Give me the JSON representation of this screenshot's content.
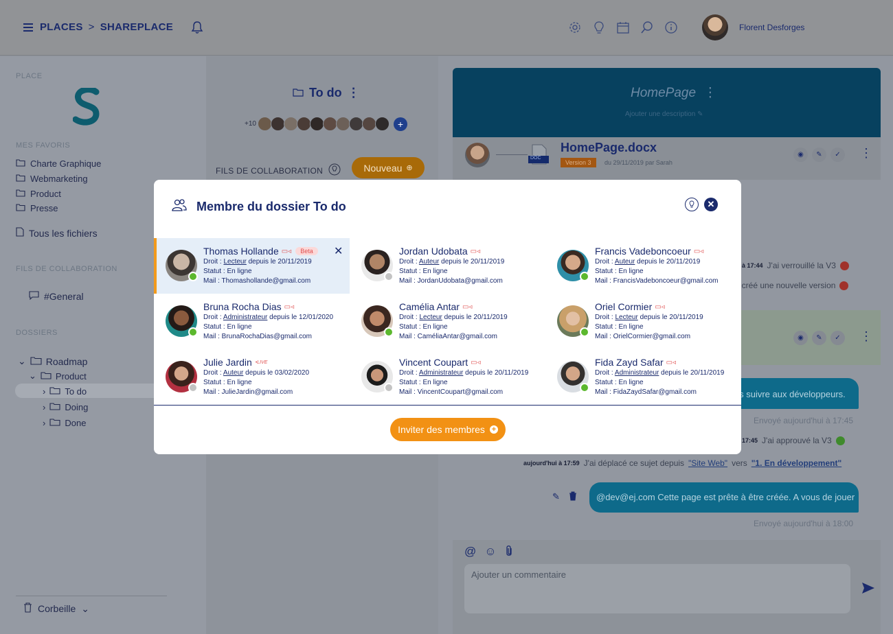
{
  "header": {
    "places_label": "PLACES",
    "crumb_separator": ">",
    "current_place": "SHAREPLACE",
    "user_name": "Florent Desforges",
    "icons": [
      "settings-icon",
      "lightbulb-icon",
      "calendar-icon",
      "search-icon",
      "info-icon"
    ]
  },
  "sidebar": {
    "place_title": "PLACE",
    "favorites_title": "MES FAVORIS",
    "favorites": [
      "Charte Graphique",
      "Webmarketing",
      "Product",
      "Presse"
    ],
    "all_files": "Tous les fichiers",
    "collab_title": "FILS DE COLLABORATION",
    "channel": "#General",
    "folders_title": "DOSSIERS",
    "tree": [
      {
        "label": "Roadmap"
      },
      {
        "label": "Product"
      },
      {
        "label": "To do"
      },
      {
        "label": "Doing"
      },
      {
        "label": "Done"
      }
    ],
    "trash": "Corbeille"
  },
  "middle": {
    "folder_title": "To do",
    "extra_members": "+10",
    "collab_label": "FILS DE COLLABORATION",
    "new_button": "Nouveau"
  },
  "right": {
    "page_title": "HomePage",
    "page_desc": "Ajouter une description",
    "doc_name": "HomePage.docx",
    "doc_type": "DOC",
    "version": "Version 3",
    "version_date": "du 29/11/2019 par Sarah",
    "log1_time": "à 17:44",
    "log1_text": "J'ai verrouillé la V3",
    "log2_text": "t créé une nouvelle version",
    "bubble1": "ais suivre aux développeurs.",
    "sent1": "Envoyé aujourd'hui à 17:45",
    "log3_time": "17:45",
    "log3_text": "J'ai approuvé la V3",
    "log4_time": "aujourd'hui à 17:59",
    "log4_a": "J'ai déplacé ce sujet depuis",
    "log4_from": "\"Site Web\"",
    "log4_vers": "vers",
    "log4_to": "\"1. En développement\"",
    "bubble2": "@dev@ej.com Cette page est prête à être créée. A vous de jouer",
    "sent2": "Envoyé aujourd'hui à 18:00",
    "comment_placeholder": "Ajouter un commentaire"
  },
  "modal": {
    "title": "Membre du dossier To do",
    "invite_button": "Inviter des membres",
    "close_symbol": "✕",
    "members": [
      {
        "name": "Thomas Hollande",
        "badge": "Beta",
        "droit_prefix": "Droit :",
        "role": "Lecteur",
        "since": "depuis le 20/11/2019",
        "statut": "Statut : En ligne",
        "mail": "Mail : Thomashollande@gmail.com",
        "online": true,
        "selected": true
      },
      {
        "name": "Jordan Udobata",
        "droit_prefix": "Droit :",
        "role": "Auteur",
        "since": "depuis le 20/11/2019",
        "statut": "Statut : En ligne",
        "mail": "Mail : JordanUdobata@gmail.com",
        "online": false
      },
      {
        "name": "Francis Vadeboncoeur",
        "droit_prefix": "Droit :",
        "role": "Auteur",
        "since": "depuis le 20/11/2019",
        "statut": "Statut : En ligne",
        "mail": "Mail : FrancisVadeboncoeur@gmail.com",
        "online": true
      },
      {
        "name": "Bruna Rocha Dias",
        "droit_prefix": "Droit :",
        "role": "Administrateur",
        "since": "depuis le 12/01/2020",
        "statut": "Statut : En ligne",
        "mail": "Mail : BrunaRochaDias@gmail.com",
        "online": true
      },
      {
        "name": "Camélia Antar",
        "droit_prefix": "Droit :",
        "role": "Lecteur",
        "since": "depuis le 20/11/2019",
        "statut": "Statut : En ligne",
        "mail": "Mail : CaméliaAntar@gmail.com",
        "online": true
      },
      {
        "name": "Oriel Cormier",
        "droit_prefix": "Droit :",
        "role": "Lecteur",
        "since": "depuis le 20/11/2019",
        "statut": "Statut : En ligne",
        "mail": "Mail : OrielCormier@gmail.com",
        "online": true
      },
      {
        "name": "Julie Jardin",
        "live": "LIVE",
        "droit_prefix": "Droit :",
        "role": "Auteur",
        "since": "depuis le 03/02/2020",
        "statut": "Statut : En ligne",
        "mail": "Mail : JulieJardin@gmail.com",
        "online": false
      },
      {
        "name": "Vincent Coupart",
        "droit_prefix": "Droit :",
        "role": "Administrateur",
        "since": "depuis le 20/11/2019",
        "statut": "Statut : En ligne",
        "mail": "Mail : VincentCoupart@gmail.com",
        "online": false
      },
      {
        "name": "Fida Zayd Safar",
        "droit_prefix": "Droit :",
        "role": "Administrateur",
        "since": "depuis le 20/11/2019",
        "statut": "Statut : En ligne",
        "mail": "Mail : FidaZaydSafar@gmail.com",
        "online": true
      }
    ]
  },
  "colors": {
    "accent_navy": "#1a2a6c",
    "accent_orange": "#f29114",
    "online_green": "#5cb82e",
    "offline_grey": "#c3c3c3",
    "selected_bg": "#e5eef8"
  }
}
